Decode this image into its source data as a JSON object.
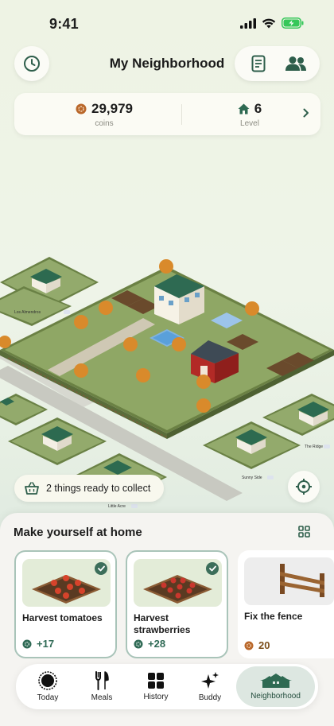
{
  "status_bar": {
    "time": "9:41"
  },
  "header": {
    "title": "My Neighborhood"
  },
  "stats": {
    "coins_value": "29,979",
    "coins_label": "coins",
    "level_value": "6",
    "level_label": "Level"
  },
  "map": {
    "labels": [
      "Los Almendros",
      "Little Acre",
      "Sunny Side",
      "The Ridge"
    ]
  },
  "collect": {
    "label": "2 things ready to collect"
  },
  "sheet": {
    "title": "Make yourself at home",
    "tasks": [
      {
        "name": "Harvest tomatoes",
        "reward": "+17",
        "ready": true
      },
      {
        "name": "Harvest strawberries",
        "reward": "+28",
        "ready": true
      },
      {
        "name": "Fix the fence",
        "reward": "20",
        "ready": false
      }
    ]
  },
  "tabbar": {
    "tabs": [
      {
        "label": "Today",
        "icon": "sun-circle-icon"
      },
      {
        "label": "Meals",
        "icon": "fork-knife-icon"
      },
      {
        "label": "History",
        "icon": "grid-icon"
      },
      {
        "label": "Buddy",
        "icon": "sparkles-icon"
      },
      {
        "label": "Neighborhood",
        "icon": "neighborhood-icon",
        "active": true
      }
    ]
  },
  "colors": {
    "accent": "#2f6a55",
    "coin": "#b9672a",
    "grass": "#8ea567",
    "roof_green": "#2e6a52",
    "barn_red": "#b22a26",
    "battery": "#35c759"
  }
}
